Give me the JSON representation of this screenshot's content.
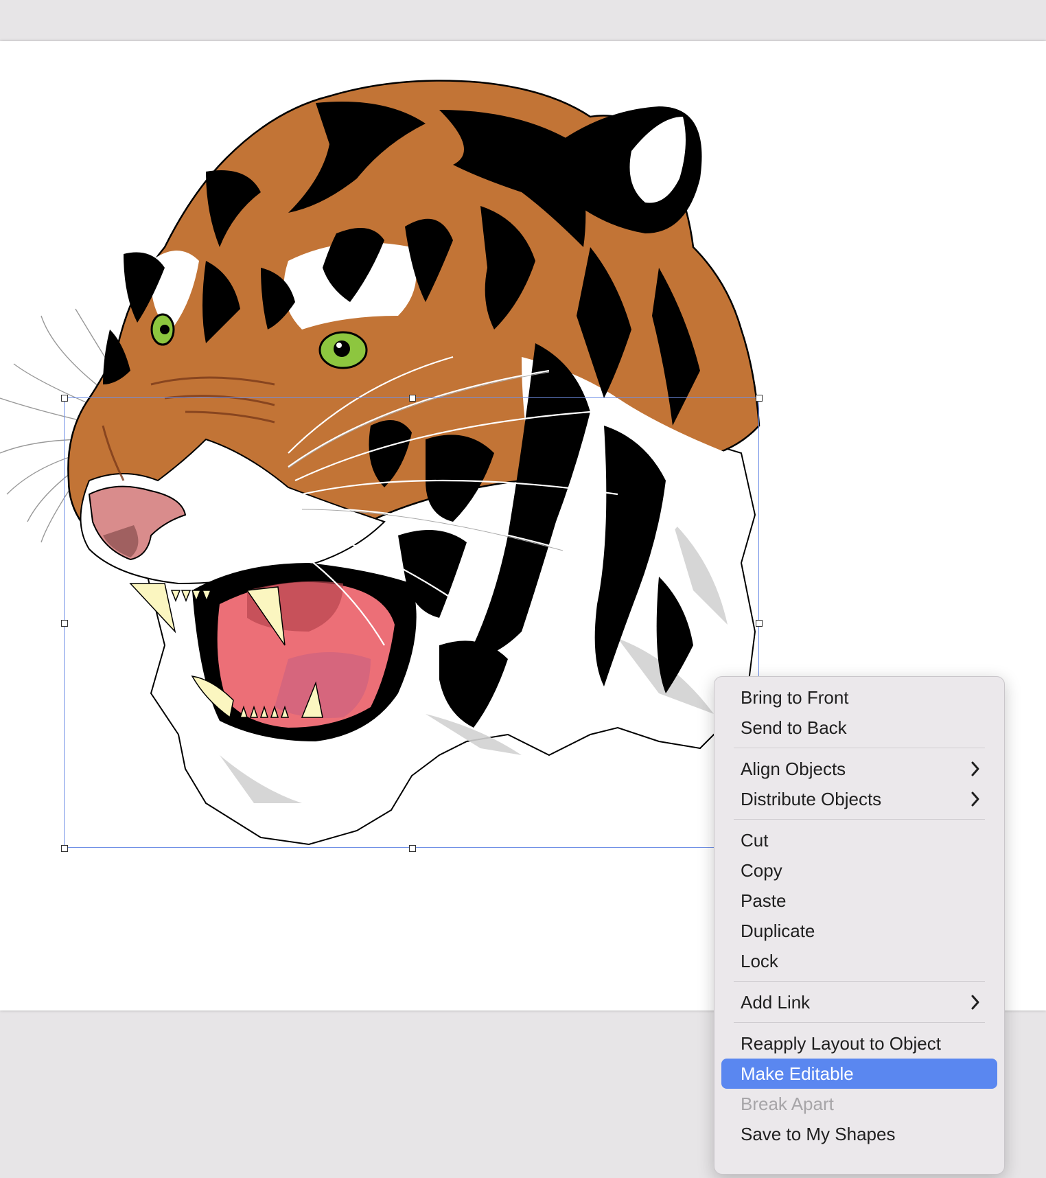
{
  "context_menu": {
    "items": {
      "bring_to_front": "Bring to Front",
      "send_to_back": "Send to Back",
      "align_objects": "Align Objects",
      "distribute_objects": "Distribute Objects",
      "cut": "Cut",
      "copy": "Copy",
      "paste": "Paste",
      "duplicate": "Duplicate",
      "lock": "Lock",
      "add_link": "Add Link",
      "reapply_layout": "Reapply Layout to Object",
      "make_editable": "Make Editable",
      "break_apart": "Break Apart",
      "save_to_my_shapes": "Save to My Shapes"
    },
    "highlighted_item": "Make Editable",
    "disabled_item": "Break Apart"
  },
  "canvas": {
    "object": "tiger-illustration",
    "selected": true
  },
  "colors": {
    "selection": "#6f8fe6",
    "highlight": "#5a87f0",
    "tiger_orange": "#c27436",
    "eye_green": "#8dc63f",
    "tongue_pink": "#ec6f77"
  }
}
